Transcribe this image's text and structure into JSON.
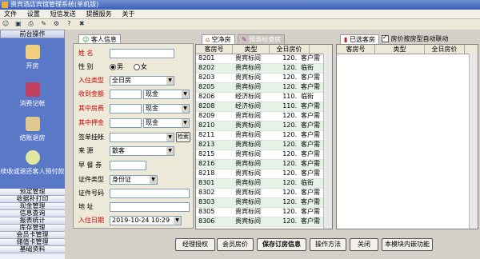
{
  "window": {
    "title": "贵宾酒店宾馆管理系统(单机版)"
  },
  "menu": [
    "文件",
    "设置",
    "短信发送",
    "提醒服务",
    "关于"
  ],
  "toolbar": {
    "icons": [
      "user-icon",
      "save-icon",
      "print-icon",
      "tools-icon",
      "settings-icon",
      "help-icon",
      "exit-icon"
    ]
  },
  "sidebar": {
    "header": "前台操作",
    "items": [
      {
        "label": "开房",
        "icon": "open-room-icon"
      },
      {
        "label": "消费记帐",
        "icon": "consume-icon"
      },
      {
        "label": "结账退房",
        "icon": "checkout-icon"
      },
      {
        "label": "续收或退还客人预付款",
        "icon": "deposit-icon"
      }
    ],
    "sections": [
      "预定管理",
      "收据补打印",
      "现金管理",
      "信息查询",
      "报表统计",
      "库存管理",
      "会员卡管理",
      "储值卡管理",
      "基础资料"
    ]
  },
  "tabs": {
    "guest_info": "客人信息",
    "empty_rooms": "空净房",
    "dirty_rooms": "预退检查房",
    "selected_rooms": "已选客房"
  },
  "form": {
    "name_label": "姓    名",
    "name_value": "",
    "gender_label": "性    别",
    "gender_male": "男",
    "gender_female": "女",
    "type_label": "入住类型",
    "type_value": "全日房",
    "deposit_label": "收到金额",
    "deposit_value": "",
    "deposit_method": "现金",
    "room_fee_label": "其中房费",
    "room_fee_value": "",
    "room_fee_method": "现金",
    "pledge_label": "其中押金",
    "pledge_value": "",
    "pledge_method": "现金",
    "sign_label": "签单挂帐",
    "sign_value": "",
    "sign_btn": "检索",
    "source_label": "来    源",
    "source_value": "散客",
    "breakfast_label": "早 餐 券",
    "breakfast_value": "",
    "id_type_label": "证件类型",
    "id_type_value": "身份证",
    "id_no_label": "证件号码",
    "id_no_value": "",
    "address_label": "地    址",
    "address_value": "",
    "checkin_label": "入住日期",
    "checkin_value": "2019-10-24 10:29"
  },
  "room_table": {
    "columns": [
      "客房号",
      "类型",
      "全日房价"
    ],
    "rows": [
      [
        "8201",
        "贵宾标间",
        "120.",
        "客户需"
      ],
      [
        "8202",
        "贵宾标间",
        "120.",
        "临街"
      ],
      [
        "8203",
        "贵宾标间",
        "120.",
        "客户需"
      ],
      [
        "8205",
        "贵宾标间",
        "120.",
        "客户需"
      ],
      [
        "8206",
        "经济标间",
        "110.",
        "临街"
      ],
      [
        "8208",
        "经济标间",
        "110.",
        "客户需"
      ],
      [
        "8209",
        "贵宾标间",
        "120.",
        "客户需"
      ],
      [
        "8210",
        "贵宾标间",
        "120.",
        "客户需"
      ],
      [
        "8211",
        "贵宾标间",
        "120.",
        "客户需"
      ],
      [
        "8213",
        "贵宾标间",
        "120.",
        "客户需"
      ],
      [
        "8215",
        "贵宾标间",
        "120.",
        "客户需"
      ],
      [
        "8216",
        "贵宾标间",
        "120.",
        "客户需"
      ],
      [
        "8218",
        "贵宾标间",
        "120.",
        "客户需"
      ],
      [
        "8301",
        "贵宾标间",
        "120.",
        "临街"
      ],
      [
        "8302",
        "贵宾标间",
        "120.",
        "客户需"
      ],
      [
        "8303",
        "贵宾标间",
        "120.",
        "客户需"
      ],
      [
        "8305",
        "贵宾标间",
        "120.",
        "客户需"
      ],
      [
        "8306",
        "贵宾标间",
        "120.",
        "客户需"
      ]
    ]
  },
  "selected_table": {
    "auto_link_label": "房价按房型自动联动",
    "auto_link_checked": true,
    "columns": [
      "客房号",
      "类型",
      "全日房价"
    ]
  },
  "buttons": {
    "authorize": "经理授权",
    "member_price": "会员房价",
    "save": "保存订房信息",
    "method": "操作方法",
    "close": "关闭",
    "help": "本模块内嵌功能"
  },
  "colors": {
    "sidebar_blue": "#5a78c8",
    "label_red": "#d00000",
    "row_alt": "#e6f2e6",
    "selection": "#316ac5"
  }
}
